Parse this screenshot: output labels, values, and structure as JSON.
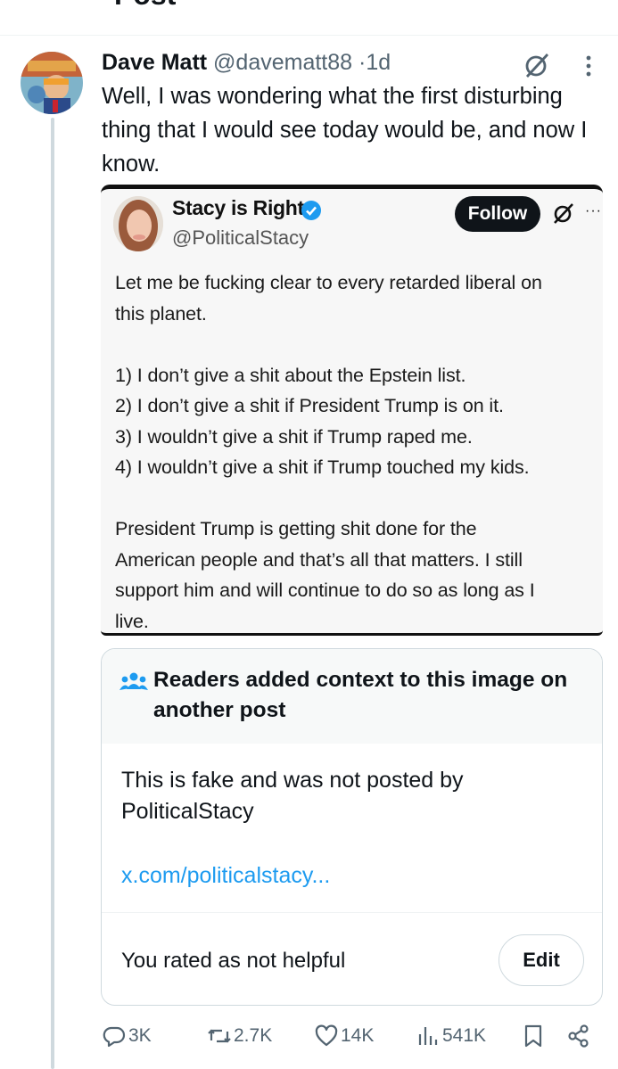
{
  "header": {
    "title": "Post"
  },
  "post": {
    "display_name": "Dave Matt",
    "handle": "@davematt88",
    "separator": "·",
    "age": "1d",
    "text": "Well, I was wondering what the first disturbing thing that I would see today would be, and now I know."
  },
  "embedded": {
    "display_name": "Stacy is Right",
    "handle": "@PoliticalStacy",
    "follow_label": "Follow",
    "more_label": "···",
    "lines": [
      "Let me be fucking clear to every retarded liberal on",
      "this planet.",
      "",
      "1) I don’t give a shit about the Epstein list.",
      "2) I don’t give a shit if President Trump is on it.",
      "3) I wouldn’t give a shit if Trump raped me.",
      "4) I wouldn’t give a shit if Trump touched my kids.",
      "",
      "President Trump is getting shit done for the",
      "American people and that’s all that matters. I still",
      "support him and will continue to do so as long as I",
      "live."
    ]
  },
  "note": {
    "heading": "Readers added context to this image on another post",
    "body": "This is fake and was not posted by PoliticalStacy",
    "link": "x.com/politicalstacy...",
    "rating": "You rated as not helpful",
    "edit_label": "Edit"
  },
  "actions": {
    "replies": "3K",
    "reposts": "2.7K",
    "likes": "14K",
    "views": "541K"
  },
  "colors": {
    "muted": "#536471",
    "link": "#1d9bf0",
    "verified": "#1d9bf0",
    "border": "#cfd9de",
    "note_bg": "#f7f9f9"
  },
  "icons": [
    "back-arrow-icon",
    "grok-icon",
    "more-icon",
    "verified-badge-icon",
    "people-icon",
    "reply-icon",
    "repost-icon",
    "like-icon",
    "views-icon",
    "bookmark-icon",
    "share-icon"
  ]
}
